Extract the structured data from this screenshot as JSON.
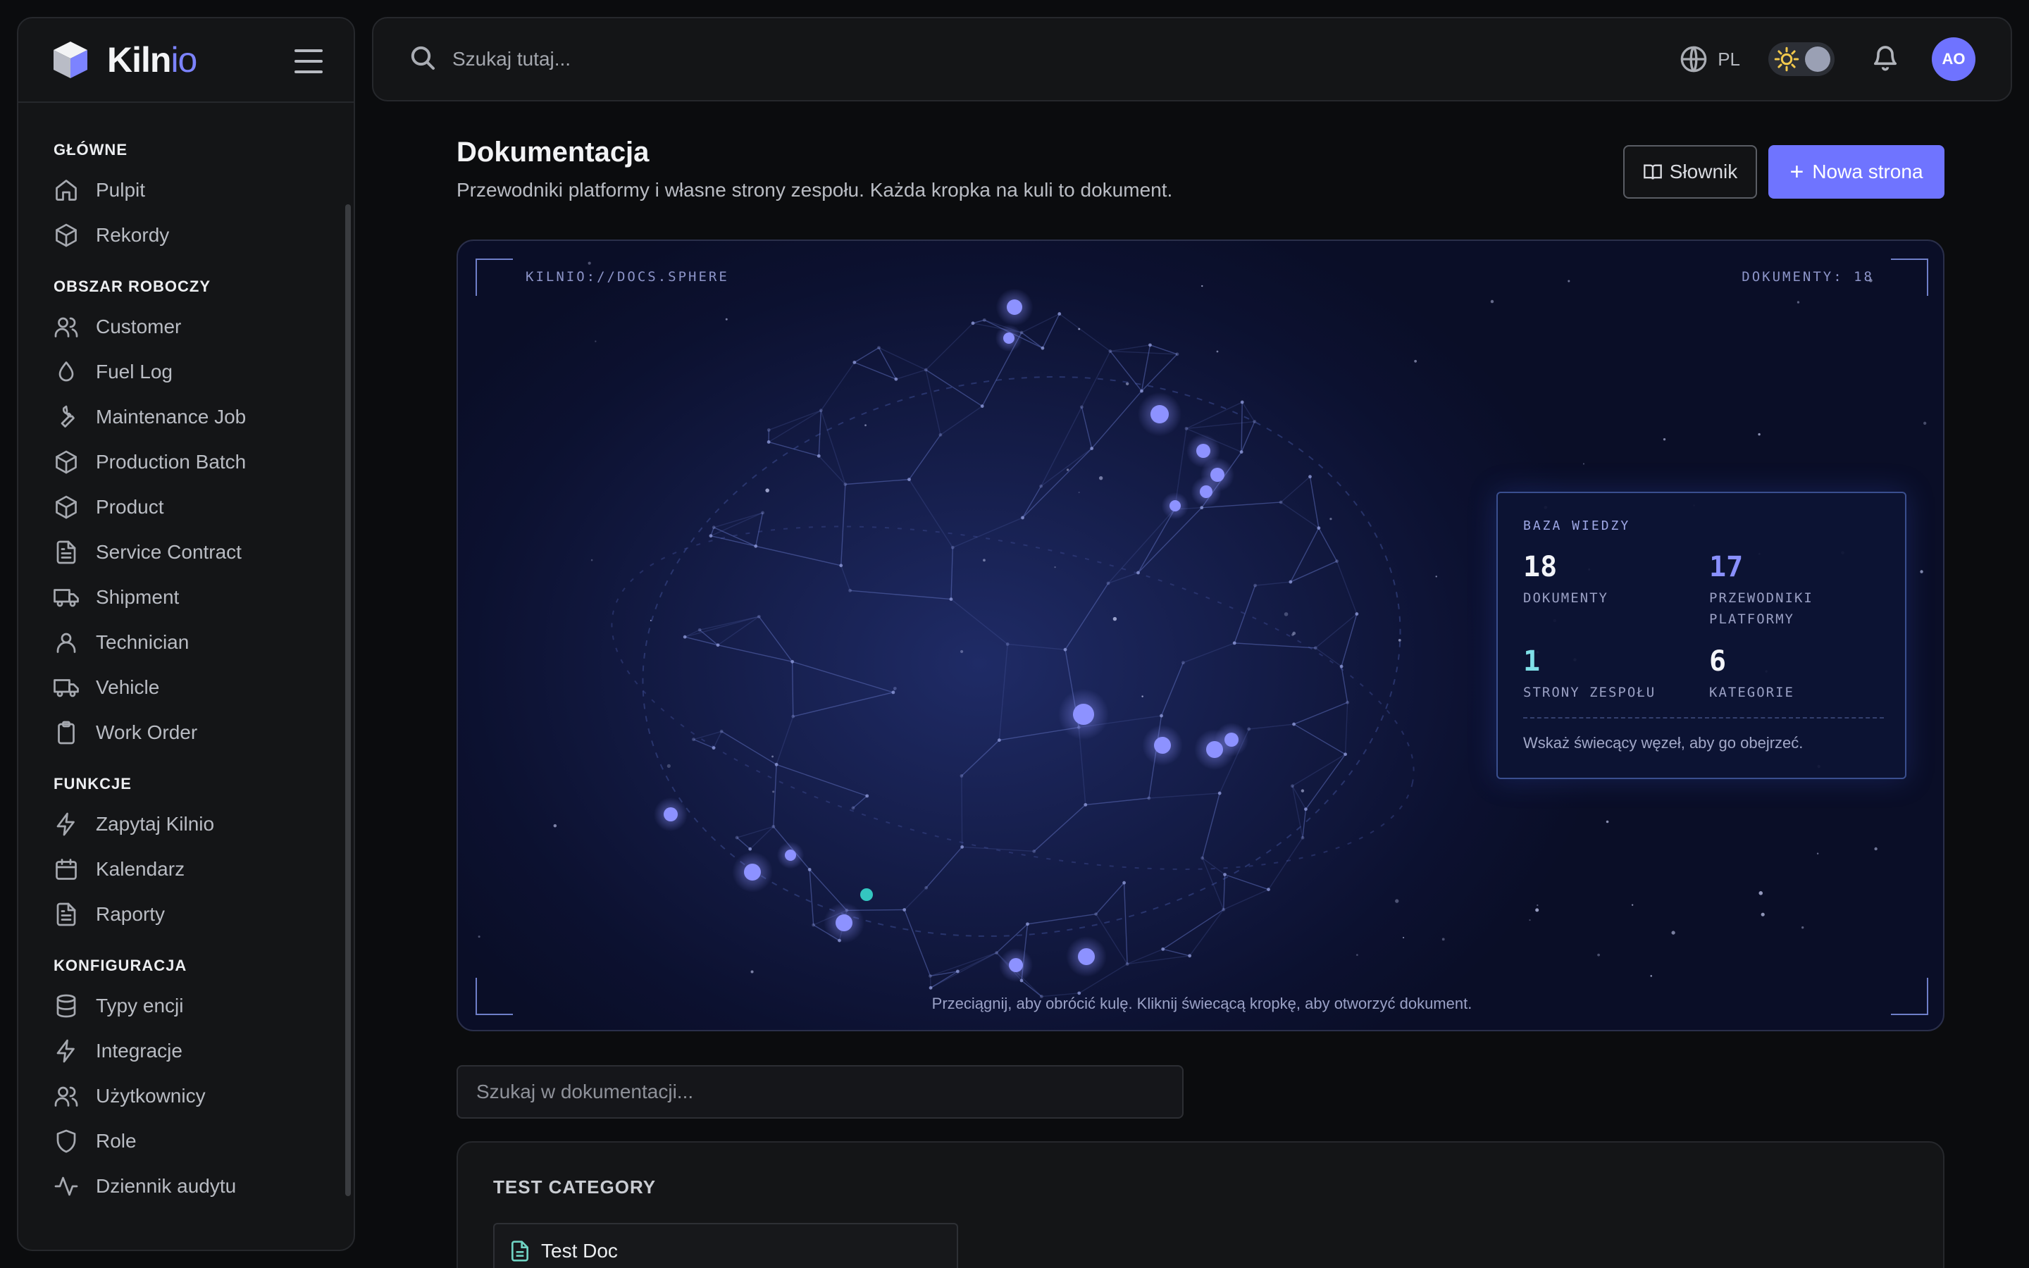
{
  "brand": {
    "name_main": "Kiln",
    "name_accent": "io"
  },
  "sidebar": {
    "sections": [
      {
        "title": "GŁÓWNE",
        "items": [
          {
            "label": "Pulpit",
            "icon": "home-icon"
          },
          {
            "label": "Rekordy",
            "icon": "box-icon"
          }
        ]
      },
      {
        "title": "OBSZAR ROBOCZY",
        "items": [
          {
            "label": "Customer",
            "icon": "users-icon"
          },
          {
            "label": "Fuel Log",
            "icon": "droplet-icon"
          },
          {
            "label": "Maintenance Job",
            "icon": "wrench-icon"
          },
          {
            "label": "Production Batch",
            "icon": "box-icon"
          },
          {
            "label": "Product",
            "icon": "box-icon"
          },
          {
            "label": "Service Contract",
            "icon": "file-text-icon"
          },
          {
            "label": "Shipment",
            "icon": "truck-icon"
          },
          {
            "label": "Technician",
            "icon": "user-icon"
          },
          {
            "label": "Vehicle",
            "icon": "truck-icon"
          },
          {
            "label": "Work Order",
            "icon": "clipboard-icon"
          }
        ]
      },
      {
        "title": "FUNKCJE",
        "items": [
          {
            "label": "Zapytaj Kilnio",
            "icon": "zap-icon"
          },
          {
            "label": "Kalendarz",
            "icon": "calendar-icon"
          },
          {
            "label": "Raporty",
            "icon": "file-text-icon"
          }
        ]
      },
      {
        "title": "KONFIGURACJA",
        "items": [
          {
            "label": "Typy encji",
            "icon": "database-icon"
          },
          {
            "label": "Integracje",
            "icon": "zap-icon"
          },
          {
            "label": "Użytkownicy",
            "icon": "users-icon"
          },
          {
            "label": "Role",
            "icon": "shield-icon"
          },
          {
            "label": "Dziennik audytu",
            "icon": "activity-icon"
          }
        ]
      }
    ]
  },
  "topbar": {
    "search_placeholder": "Szukaj tutaj...",
    "language": "PL",
    "avatar_initials": "AO"
  },
  "page": {
    "title": "Dokumentacja",
    "subtitle": "Przewodniki platformy i własne strony zespołu. Każda kropka na kuli to dokument.",
    "glossary_button": "Słownik",
    "new_page_button": "Nowa strona"
  },
  "sphere": {
    "tag_left": "KILNIO://DOCS.SPHERE",
    "tag_right": "DOKUMENTY: 18",
    "hint": "Przeciągnij, aby obrócić kulę. Kliknij świecącą kropkę, aby otworzyć dokument.",
    "knowledge_base": {
      "title": "BAZA WIEDZY",
      "stats": [
        {
          "value": "18",
          "label": "DOKUMENTY"
        },
        {
          "value": "17",
          "label": "PRZEWODNIKI PLATFORMY"
        },
        {
          "value": "1",
          "label": "STRONY ZESPOŁU"
        },
        {
          "value": "6",
          "label": "KATEGORIE"
        }
      ],
      "footer": "Wskaż świecący węzeł, aby go obejrzeć."
    },
    "colors": {
      "node": "#8d92ff",
      "team_node": "#34c6c0",
      "mesh": "#5b6bb8"
    }
  },
  "docs": {
    "search_placeholder": "Szukaj w dokumentacji...",
    "categories": [
      {
        "title": "TEST CATEGORY",
        "documents": [
          {
            "title": "Test Doc"
          }
        ]
      }
    ]
  }
}
